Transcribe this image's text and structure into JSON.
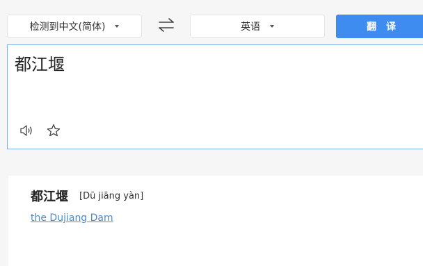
{
  "toolbar": {
    "source_language": "检测到中文(简体)",
    "target_language": "英语",
    "translate_label": "翻译"
  },
  "input": {
    "text": "都江堰"
  },
  "result": {
    "word": "都江堰",
    "pinyin": "[Dū jiāng yàn]",
    "meaning": "the Dujiang Dam"
  },
  "colors": {
    "accent": "#3f8cf0",
    "input_border": "#7aaee6",
    "link": "#4a8ac9",
    "background": "#f6f6f6"
  },
  "icons": {
    "swap": "swap-arrows-icon",
    "speaker": "speaker-icon",
    "favorite": "star-icon",
    "dropdown": "chevron-down-icon"
  }
}
